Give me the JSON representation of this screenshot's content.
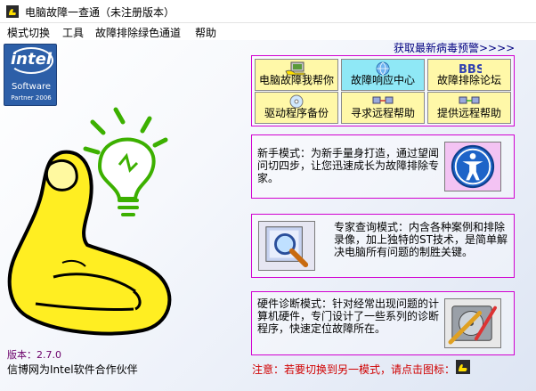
{
  "window": {
    "title": "电脑故障一查通（未注册版本）"
  },
  "menu": {
    "items": [
      "模式切换",
      "工具",
      "故障排除绿色通道",
      "帮助"
    ]
  },
  "intel_badge": {
    "brand": "intel",
    "line1": "Software",
    "line2": "Partner 2006"
  },
  "news_link": "获取最新病毒预警>>>>",
  "buttons": [
    {
      "label": "电脑故障我帮你",
      "icon": "hand-computer-icon"
    },
    {
      "label": "故障响应中心",
      "icon": "globe-icon"
    },
    {
      "label": "故障排除论坛",
      "icon": "bbs-icon"
    },
    {
      "label": "驱动程序备份",
      "icon": "cd-icon"
    },
    {
      "label": "寻求远程帮助",
      "icon": "network-icon"
    },
    {
      "label": "提供远程帮助",
      "icon": "network-icon"
    }
  ],
  "modes": {
    "beginner": "新手模式：为新手量身打造，通过望闻问切四步，让您迅速成长为故障排除专家。",
    "expert": "专家查询模式：内含各种案例和排除录像，加上独特的ST技术，是简单解决电脑所有问题的制胜关键。",
    "hardware": "硬件诊断模式：针对经常出现问题的计算机硬件，专门设计了一些系列的诊断程序，快速定位故障所在。"
  },
  "footer": {
    "version": "版本：2.7.0",
    "partner": "信博网为Intel软件合作伙伴",
    "notice": "注意：若要切换到另一模式，请点击图标："
  },
  "colors": {
    "panel_border": "#d100d1",
    "button_yellow": "#fff8a8",
    "button_blue": "#8fe8f6",
    "link_blue": "#000080",
    "notice_red": "#d00000",
    "version_purple": "#6b006b",
    "mascot_yellow": "#ffee22"
  }
}
